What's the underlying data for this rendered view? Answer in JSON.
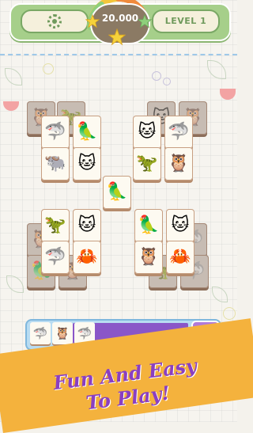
{
  "header": {
    "score": "20.000",
    "level": "LEVEL 1",
    "settings_icon": "gear-icon"
  },
  "colors": {
    "header_bg": "#a6cf8a",
    "tray_fill": "#8a56c8",
    "promo_bg": "#f4b23d",
    "promo_text": "#8a3fc1"
  },
  "tiles": [
    {
      "animal": "owl",
      "glyph": "🦉",
      "dim": true
    },
    {
      "animal": "dinosaur",
      "glyph": "🦖",
      "dim": true
    },
    {
      "animal": "shark",
      "glyph": "🦈",
      "dim": false
    },
    {
      "animal": "parrot",
      "glyph": "🦜",
      "dim": false
    },
    {
      "animal": "yak",
      "glyph": "🐃",
      "dim": false
    },
    {
      "animal": "cat",
      "glyph": "🐱",
      "dim": false
    },
    {
      "animal": "cat",
      "glyph": "🐱",
      "dim": true
    },
    {
      "animal": "owl",
      "glyph": "🦉",
      "dim": true
    },
    {
      "animal": "cat",
      "glyph": "🐱",
      "dim": false
    },
    {
      "animal": "shark",
      "glyph": "🦈",
      "dim": false
    },
    {
      "animal": "dinosaur",
      "glyph": "🦖",
      "dim": false
    },
    {
      "animal": "owl",
      "glyph": "🦉",
      "dim": false
    },
    {
      "animal": "parrot",
      "glyph": "🦜",
      "dim": false
    },
    {
      "animal": "dinosaur",
      "glyph": "🦖",
      "dim": false
    },
    {
      "animal": "cat",
      "glyph": "🐱",
      "dim": false
    },
    {
      "animal": "shark",
      "glyph": "🦈",
      "dim": false
    },
    {
      "animal": "crab",
      "glyph": "🦀",
      "dim": false
    },
    {
      "animal": "parrot",
      "glyph": "🦜",
      "dim": false
    },
    {
      "animal": "cat",
      "glyph": "🐱",
      "dim": false
    },
    {
      "animal": "owl",
      "glyph": "🦉",
      "dim": false
    },
    {
      "animal": "crab",
      "glyph": "🦀",
      "dim": false
    }
  ],
  "tray": {
    "slots": [
      {
        "animal": "shark",
        "glyph": "🦈"
      },
      {
        "animal": "owl",
        "glyph": "🦉"
      },
      {
        "animal": "shark",
        "glyph": "🦈"
      }
    ],
    "add_button": "+"
  },
  "promo": {
    "line1": "Fun And Easy",
    "line2": "To Play!"
  }
}
